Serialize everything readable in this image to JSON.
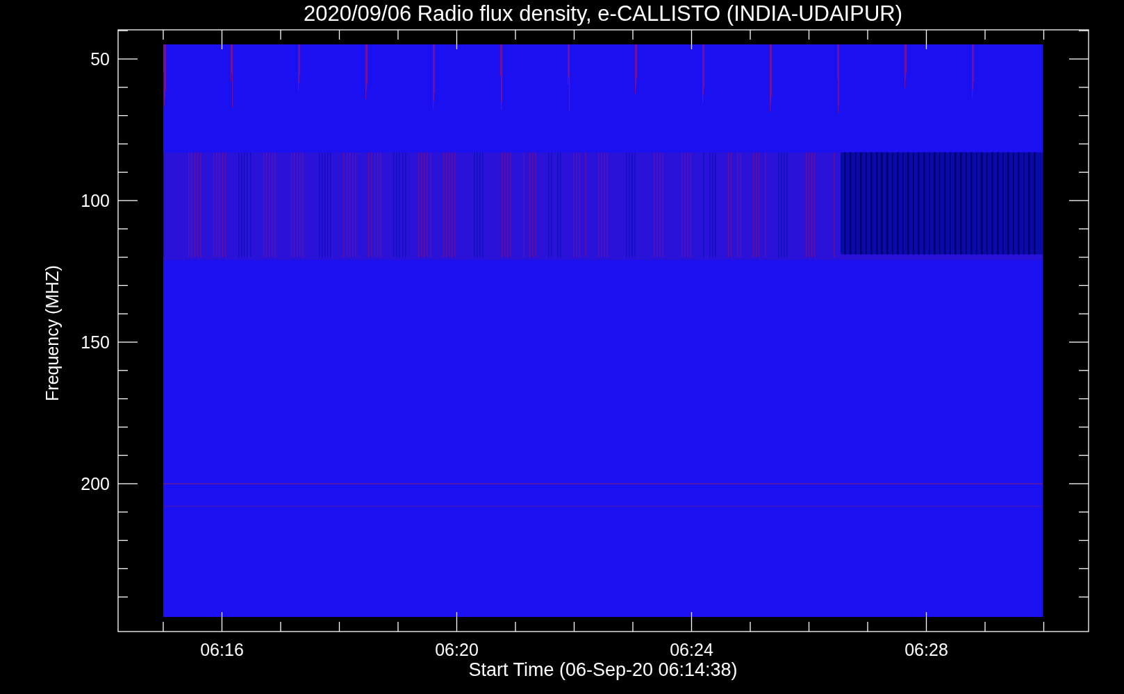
{
  "title": "2020/09/06  Radio flux density, e-CALLISTO (INDIA-UDAIPUR)",
  "y_axis": {
    "label": "Frequency (MHZ)",
    "tick_labels": [
      "50",
      "100",
      "150",
      "200"
    ]
  },
  "x_axis": {
    "label": "Start Time (06-Sep-20 06:14:38)",
    "tick_labels": [
      "06:16",
      "06:20",
      "06:24",
      "06:28"
    ]
  }
}
